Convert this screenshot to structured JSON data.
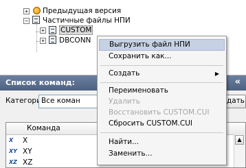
{
  "tree": {
    "prev_version": "Предыдущая версия",
    "partial_files": "Частичные файлы НПИ",
    "custom": "CUSTOM",
    "dbconn": "DBCONN"
  },
  "commands_panel": {
    "title": "Список команд:",
    "collapse_glyph": "«",
    "categories_label": "Категории:",
    "categories_value": "Все коман",
    "button_fragment": "дать",
    "column_command": "Команда",
    "rows": [
      {
        "icon": "X",
        "name": "X"
      },
      {
        "icon": "XY",
        "name": "XY"
      },
      {
        "icon": "XZ",
        "name": "XZ"
      }
    ],
    "row3_tail": "ᴀᴀᴀ"
  },
  "context_menu": {
    "items": [
      {
        "label": "Выгрузить файл НПИ",
        "enabled": true,
        "highlighted": true
      },
      {
        "label": "Сохранить как...",
        "enabled": true
      },
      {
        "label": "Создать",
        "enabled": true,
        "submenu": true
      },
      {
        "label": "Переименовать",
        "enabled": true
      },
      {
        "label": "Удалить",
        "enabled": false
      },
      {
        "label": "Восстановить CUSTOM.CUI",
        "enabled": false
      },
      {
        "label": "Сбросить CUSTOM.CUI",
        "enabled": true
      },
      {
        "label": "Найти...",
        "enabled": true
      },
      {
        "label": "Заменить...",
        "enabled": true
      }
    ]
  },
  "colors": {
    "header": "#5a6e90",
    "menu_highlight": "#c6d2e3",
    "disabled_text": "#a6a6a6"
  }
}
